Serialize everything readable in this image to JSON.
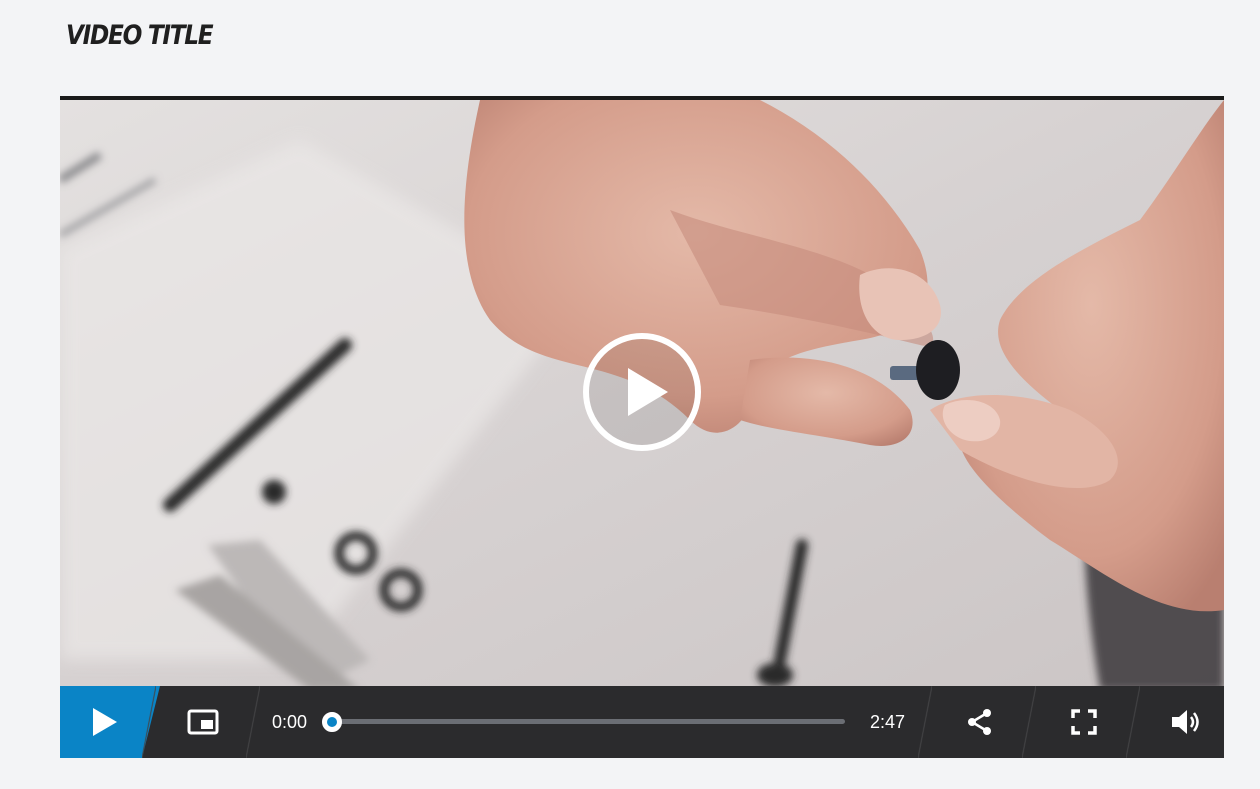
{
  "page": {
    "title": "VIDEO TITLE"
  },
  "player": {
    "current_time": "0:00",
    "duration": "2:47",
    "progress": 0,
    "accent_color": "#0a84c6",
    "controls": {
      "play_icon": "play-icon",
      "pip_icon": "picture-in-picture-icon",
      "share_icon": "share-icon",
      "fullscreen_icon": "fullscreen-icon",
      "volume_icon": "volume-icon"
    },
    "overlay_icon": "play-circle-icon"
  }
}
